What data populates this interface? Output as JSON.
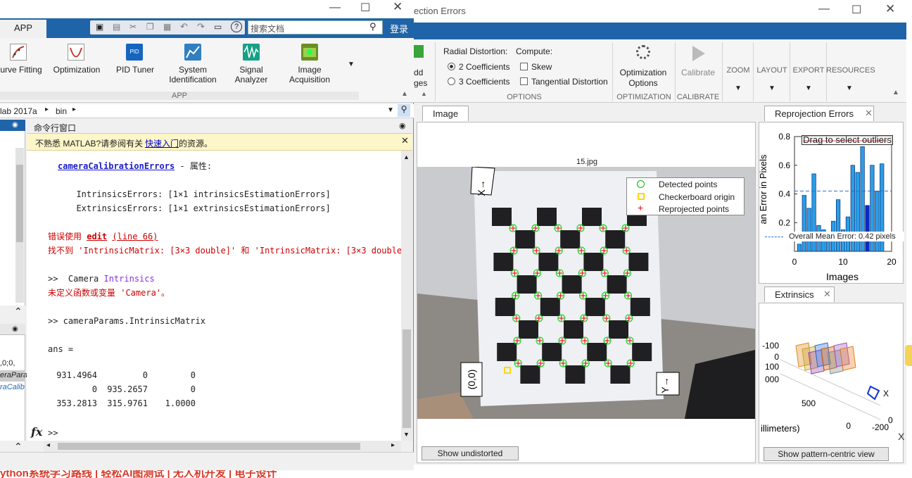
{
  "cal": {
    "title": "ection Errors",
    "ribbon": {
      "add_images": [
        "dd",
        "ges"
      ],
      "radial_label": "Radial Distortion:",
      "radial_options": [
        "2 Coefficients",
        "3 Coefficients"
      ],
      "compute_label": "Compute:",
      "compute_options": [
        "Skew",
        "Tangential Distortion"
      ],
      "options_group": "OPTIONS",
      "opt_btn": [
        "Optimization",
        "Options"
      ],
      "optimization_group": "OPTIMIZATION",
      "calibrate_btn": "Calibrate",
      "calibrate_group": "CALIBRATE",
      "zoom": "ZOOM",
      "layout": "LAYOUT",
      "export": "EXPORT",
      "resources": "RESOURCES"
    },
    "image_tab": "Image",
    "image_title": "15.jpg",
    "legend": [
      "Detected points",
      "Checkerboard origin",
      "Reprojected points"
    ],
    "origin_label": "(0,0)",
    "x_label": "X→",
    "y_label": "Y→",
    "show_undistorted": "Show undistorted",
    "reproj_tab": "Reprojection Errors",
    "reproj_drag": "Drag to select outliers",
    "reproj_mean": "Overall Mean Error: 0.42 pixels",
    "reproj_xlabel": "Images",
    "reproj_ylabel": "an Error in Pixels",
    "reproj_yticks": [
      "0.8",
      "0.6",
      "0.4",
      "0.2"
    ],
    "reproj_xticks": [
      "0",
      "10",
      "20"
    ],
    "extr_tab": "Extrinsics",
    "extr_ticks": [
      "-100",
      "0",
      "100",
      "000",
      "500",
      "0",
      "-200",
      "0"
    ],
    "extr_label": "illimeters)",
    "extr_x": "X",
    "show_pattern": "Show pattern-centric view",
    "right_edge": "X"
  },
  "matlab": {
    "app_tab": "APP",
    "search_placeholder": "搜索文档",
    "login": "登录",
    "apps": [
      "urve Fitting",
      "Optimization",
      "PID Tuner",
      "System Identification",
      "Signal Analyzer",
      "Image Acquisition"
    ],
    "pid_badge": "PID",
    "app_group": "APP",
    "path": [
      "lab 2017a",
      "bin"
    ],
    "cmd_title": "命令行窗口",
    "notice": "不熟悉 MATLAB?请参阅有关",
    "notice_link": "快速入门",
    "notice_tail": "的资源。",
    "workspace_items": [
      ",0;0,",
      "eraPara",
      "raCalib"
    ],
    "prompt": ">>",
    "fx": "fx",
    "taskbar": "ython系统学习路线 | 轻松AI图测试 | 无人机开发 | 电子设计"
  },
  "console": {
    "line1_link": "cameraCalibrationErrors",
    "line1_rest": " - 属性:",
    "intr": "  IntrinsicsErrors: [1×1 intrinsicsEstimationErrors]",
    "extr": "  ExtrinsicsErrors: [1×1 extrinsicsEstimationErrors]",
    "err1_pre": "错误使用 ",
    "err1_edit": "edit",
    "err1_line": "(line 66)",
    "err2": "找不到 'IntrinsicMatrix: [3×3 double]' 和 'IntrinsicMatrix: [3×3 double",
    "cmd1_prompt": ">>  Camera ",
    "cmd1_word": "Intrinsics",
    "err3": "未定义函数或变量 'Camera'。",
    "cmd2": ">> cameraParams.IntrinsicMatrix",
    "ans": "ans =",
    "matrix_rows": [
      [
        "931.4964",
        "0",
        "0"
      ],
      [
        "0",
        "935.2657",
        "0"
      ],
      [
        "353.2813",
        "315.9761",
        "1.0000"
      ]
    ]
  },
  "chart_data": {
    "type": "bar",
    "title": "",
    "xlabel": "Images",
    "ylabel": "an Error in Pixels",
    "x": [
      1,
      2,
      3,
      4,
      5,
      6,
      7,
      8,
      9,
      10,
      11,
      12,
      13,
      14,
      15,
      16,
      17,
      18
    ],
    "values": [
      0.05,
      0.39,
      0.3,
      0.54,
      0.18,
      0.15,
      0.12,
      0.21,
      0.36,
      0.15,
      0.24,
      0.6,
      0.55,
      0.73,
      0.32,
      0.6,
      0.42,
      0.61
    ],
    "mean": 0.42,
    "xlim": [
      0,
      20
    ],
    "ylim": [
      0,
      0.8
    ],
    "colors": {
      "bar": "#2a9de6",
      "selected": "#0a2bc2",
      "mean": "#2a70c8",
      "threshold": "#e01010"
    }
  }
}
